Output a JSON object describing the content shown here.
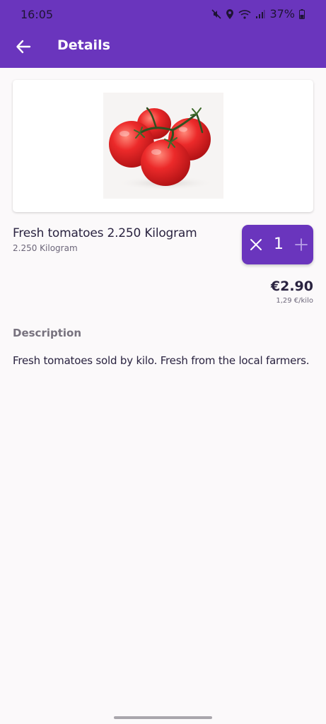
{
  "status_bar": {
    "time": "16:05",
    "battery": "37%",
    "icons": [
      "mute-icon",
      "location-icon",
      "wifi-icon",
      "signal-icon",
      "battery-icon"
    ]
  },
  "app_bar": {
    "title": "Details",
    "back_icon": "arrow-left-icon",
    "color": "#6a35bd"
  },
  "product": {
    "image_icon": "tomatoes-image",
    "name": "Fresh tomatoes 2.250 Kilogram",
    "unit": "2.250 Kilogram",
    "price": "€2.90",
    "unit_price": "1,29 €/kilo"
  },
  "quantity": {
    "value": "1",
    "remove_icon": "close-icon",
    "add_icon": "plus-icon"
  },
  "description": {
    "heading": "Description",
    "text": "Fresh tomatoes sold by kilo. Fresh from the local farmers."
  }
}
